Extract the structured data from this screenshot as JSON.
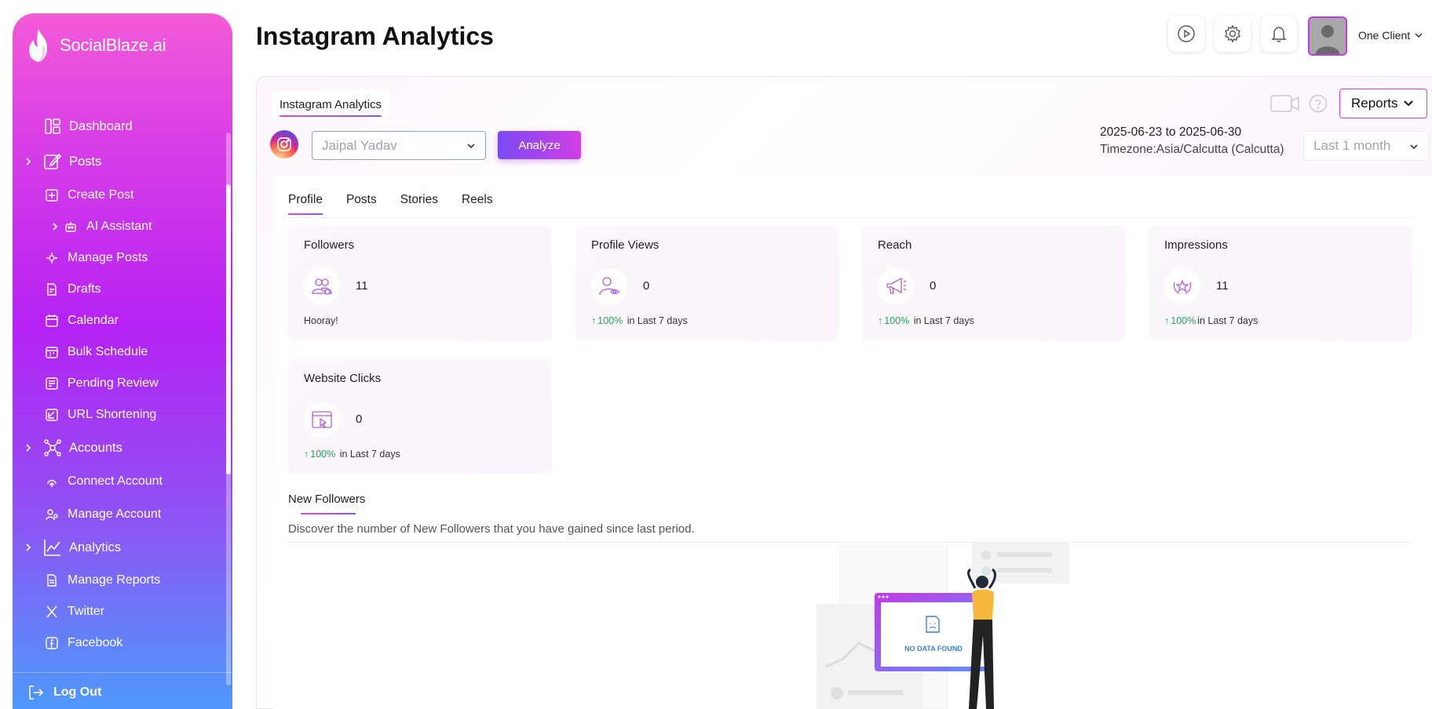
{
  "brand": {
    "name": "SocialBlaze.ai"
  },
  "sidebar": {
    "dashboard": "Dashboard",
    "posts": "Posts",
    "create_post": "Create Post",
    "ai_assistant": "AI Assistant",
    "manage_posts": "Manage Posts",
    "drafts": "Drafts",
    "calendar": "Calendar",
    "bulk_schedule": "Bulk Schedule",
    "pending_review": "Pending Review",
    "url_shortening": "URL Shortening",
    "accounts": "Accounts",
    "connect_account": "Connect Account",
    "manage_account": "Manage Account",
    "analytics": "Analytics",
    "manage_reports": "Manage Reports",
    "twitter": "Twitter",
    "facebook": "Facebook",
    "logout": "Log Out"
  },
  "header": {
    "title": "Instagram Analytics",
    "client_name": "One Client"
  },
  "card": {
    "tab_label": "Instagram Analytics",
    "account_select": "Jaipal Yadav",
    "analyze_label": "Analyze",
    "reports_label": "Reports",
    "date_range": "2025-06-23 to 2025-06-30",
    "timezone": "Timezone:Asia/Calcutta (Calcutta)",
    "period_select": "Last 1 month"
  },
  "tabs": [
    "Profile",
    "Posts",
    "Stories",
    "Reels"
  ],
  "stats": {
    "followers": {
      "title": "Followers",
      "value": "11",
      "footer": "Hooray!"
    },
    "profile_views": {
      "title": "Profile Views",
      "value": "0",
      "pct": "100%",
      "suffix": " in Last 7 days"
    },
    "reach": {
      "title": "Reach",
      "value": "0",
      "pct": "100%",
      "suffix": " in Last 7 days"
    },
    "impressions": {
      "title": "Impressions",
      "value": "11",
      "pct": "100%",
      "suffix": "in Last 7 days"
    },
    "website_clicks": {
      "title": "Website Clicks",
      "value": "0",
      "pct": "100%",
      "suffix": " in Last 7 days"
    }
  },
  "new_followers": {
    "title": "New Followers",
    "description": "Discover the number of New Followers that you have gained since last period.",
    "empty_label": "NO DATA FOUND"
  },
  "colors": {
    "accent_pink": "#d23de6",
    "accent_purple": "#7b4bf5",
    "positive": "#22a35a"
  }
}
